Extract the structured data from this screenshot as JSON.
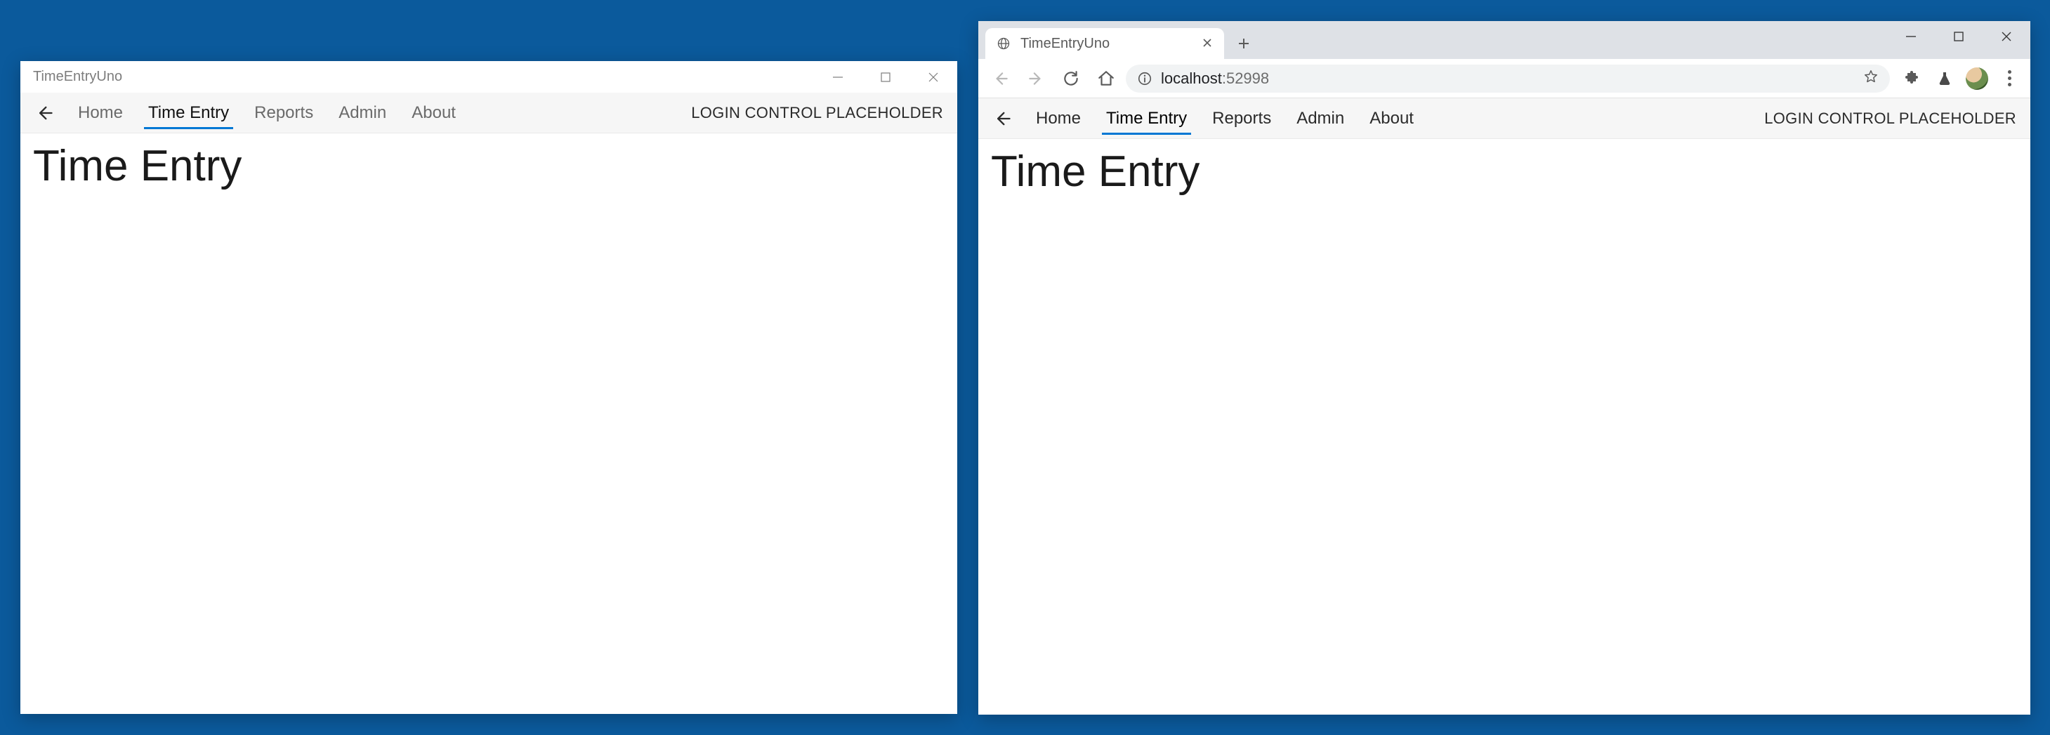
{
  "native_window": {
    "title": "TimeEntryUno"
  },
  "browser_window": {
    "tab_title": "TimeEntryUno",
    "url_host": "localhost",
    "url_port": ":52998"
  },
  "app": {
    "nav": {
      "home": "Home",
      "time_entry": "Time Entry",
      "reports": "Reports",
      "admin": "Admin",
      "about": "About"
    },
    "login_placeholder": "LOGIN CONTROL PLACEHOLDER",
    "heading": "Time Entry"
  }
}
